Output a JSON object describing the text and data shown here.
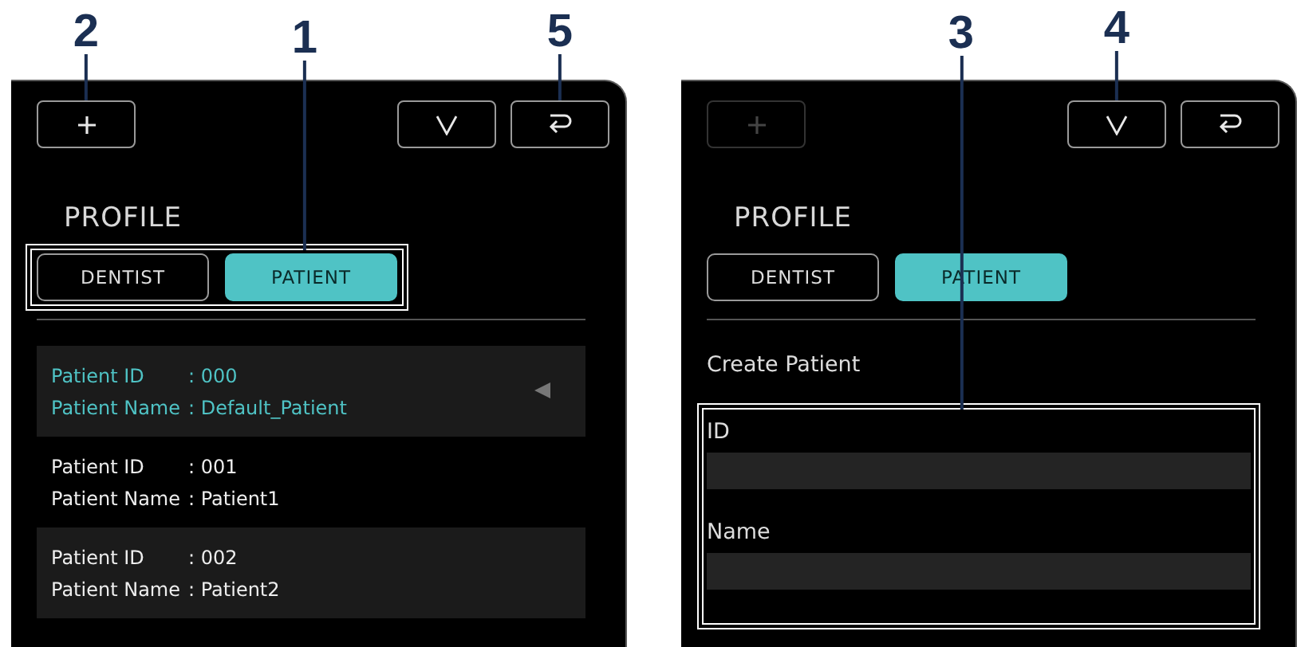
{
  "panels": [
    {
      "kind": "list",
      "toolbar": {
        "add": {
          "disabled": false,
          "callout": "2"
        },
        "confirm": {
          "disabled": false
        },
        "back": {
          "disabled": false,
          "callout": "5"
        }
      },
      "title": "PROFILE",
      "tabs_callout": "1",
      "tabs": [
        {
          "label": "DENTIST",
          "selected": false
        },
        {
          "label": "PATIENT",
          "selected": true
        }
      ],
      "patients": [
        {
          "id_label": "Patient ID",
          "id_value": ": 000",
          "name_label": "Patient Name",
          "name_value": ": Default_Patient",
          "selected": true
        },
        {
          "id_label": "Patient ID",
          "id_value": ": 001",
          "name_label": "Patient Name",
          "name_value": ": Patient1",
          "selected": false
        },
        {
          "id_label": "Patient ID",
          "id_value": ": 002",
          "name_label": "Patient Name",
          "name_value": ": Patient2",
          "selected": false
        }
      ]
    },
    {
      "kind": "form",
      "toolbar": {
        "add": {
          "disabled": true
        },
        "confirm": {
          "disabled": false,
          "callout": "4"
        },
        "back": {
          "disabled": false
        }
      },
      "title": "PROFILE",
      "tabs": [
        {
          "label": "DENTIST",
          "selected": false
        },
        {
          "label": "PATIENT",
          "selected": true
        }
      ],
      "heading": "Create Patient",
      "fields_callout": "3",
      "fields": [
        {
          "label": "ID"
        },
        {
          "label": "Name"
        }
      ]
    }
  ]
}
